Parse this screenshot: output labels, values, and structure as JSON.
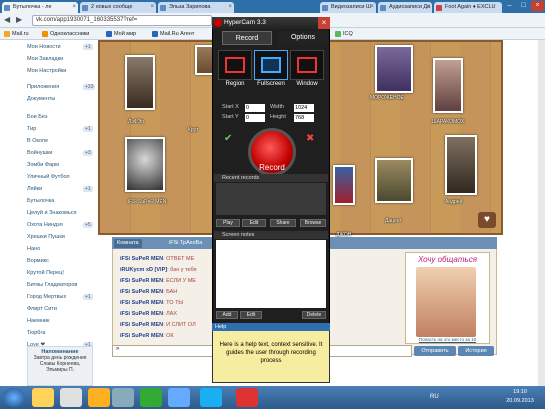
{
  "browser": {
    "tabs": [
      {
        "label": "Бутылочка - ле",
        "color": "#5d8ac2"
      },
      {
        "label": "2 новых сообще",
        "color": "#5d8ac2"
      },
      {
        "label": "Эльза Зарипова",
        "color": "#5d8ac2"
      },
      {
        "label": "Видеозаписи Ш",
        "color": "#5d8ac2"
      },
      {
        "label": "Аудиозаписи Да",
        "color": "#5d8ac2"
      },
      {
        "label": "Foot Again ♦ EXCLU",
        "color": "#d04040"
      }
    ],
    "url": "vk.com/app1930071_160335537?ref=",
    "bookmarks": [
      "Mail.ru",
      "Одноклассники",
      "Мой мир",
      "Mail.Ru Агент",
      "ICQ"
    ]
  },
  "left_menu": {
    "items": [
      {
        "label": "Мои Новости",
        "count": "+1"
      },
      {
        "label": "Мои Закладки",
        "count": ""
      },
      {
        "label": "Мои Настройки",
        "count": ""
      },
      {
        "label": "Приложения",
        "count": "+33"
      },
      {
        "label": "Документы",
        "count": ""
      },
      {
        "label": "Бои Без",
        "count": ""
      },
      {
        "label": "Тир",
        "count": "+1"
      },
      {
        "label": "В Окопе",
        "count": ""
      },
      {
        "label": "Войнушки",
        "count": "+3"
      },
      {
        "label": "Зомби Фарм",
        "count": ""
      },
      {
        "label": "Уличный Футбол",
        "count": ""
      },
      {
        "label": "Ляйки",
        "count": "+1"
      },
      {
        "label": "Бутылочка",
        "count": ""
      },
      {
        "label": "Целуй и Знакомься",
        "count": ""
      },
      {
        "label": "Охота Ниндзя",
        "count": "+5"
      },
      {
        "label": "Хрешки Пушки",
        "count": ""
      },
      {
        "label": "Нано",
        "count": ""
      },
      {
        "label": "Вормикс",
        "count": ""
      },
      {
        "label": "Крутой Перец!",
        "count": ""
      },
      {
        "label": "Битвы Гладиаторов",
        "count": ""
      },
      {
        "label": "Город Мертвых",
        "count": "+1"
      },
      {
        "label": "Флирт Сити",
        "count": ""
      },
      {
        "label": "Наемник",
        "count": ""
      },
      {
        "label": "Тюрбга",
        "count": ""
      },
      {
        "label": "Love ❤",
        "count": "+1"
      }
    ],
    "reminder_title": "Напоминание",
    "reminder_text": "Завтра день рождения Славы Корнеева, Эльмиры П."
  },
  "game": {
    "players": [
      "ЛэФЭо",
      "МОРОЖЕНОЕ",
      "ШАРАКОМОХ",
      "iFSi SuPeR MEN",
      "ДЖОН",
      "Сердце",
      "Дацент",
      "Андрей",
      "Крут"
    ]
  },
  "chat": {
    "tabs": [
      "Комната",
      "iFSi ТрАхоВа"
    ],
    "lines": [
      {
        "nick": "iFSi SuPeR MEN",
        "msg": ": ОТВЕТ МЕ"
      },
      {
        "nick": "iRUKycm xD [VIP]",
        "msg": ": бан у тебя"
      },
      {
        "nick": "iFSi SuPeR MEN",
        "msg": ": ЕСЛИ У МЕ"
      },
      {
        "nick": "iFSi SuPeR MEN",
        "msg": ": БАН"
      },
      {
        "nick": "iFSi SuPeR MEN",
        "msg": ": ТО ТЫ"
      },
      {
        "nick": "iFSi SuPeR MEN",
        "msg": ": ЛАХ"
      },
      {
        "nick": "iFSi SuPeR MEN",
        "msg": ": И СЛИТ ОЛ"
      },
      {
        "nick": "iFSi SuPeR MEN",
        "msg": ": ОК"
      }
    ],
    "ad_title": "Хочу общаться",
    "ad_caption": "Попасть на это место за 10",
    "send_label": "Отправить",
    "history_label": "История"
  },
  "hypercam": {
    "title": "HyperCam 3.3",
    "tab_record": "Record",
    "tab_options": "Options",
    "modes": [
      "Region",
      "Fullscreen",
      "Window"
    ],
    "start_x_label": "Start X",
    "start_x": "0",
    "start_y_label": "Start Y",
    "start_y": "0",
    "width_label": "Width",
    "width": "1024",
    "height_label": "Height",
    "height": "768",
    "record_label": "Record",
    "recent_records": "Recent records",
    "screen_notes": "Screen notes",
    "btns_recent": [
      "Play",
      "Edit",
      "Share",
      "Browse"
    ],
    "btns_notes": [
      "Add",
      "Edit",
      "Delete"
    ],
    "help_title": "Help",
    "help_text": "Here is a help text, context sensitive. It guides the user through recording process"
  },
  "taskbar": {
    "lang": "RU",
    "time": "19:10",
    "date": "20.09.2013"
  }
}
